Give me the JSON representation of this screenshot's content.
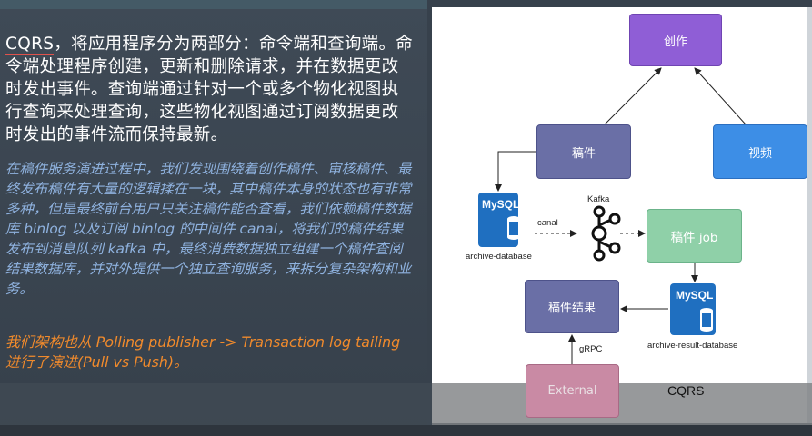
{
  "left": {
    "main_word": "CQRS",
    "main_rest": "，将应用程序分为两部分：命令端和查询端。命令端处理程序创建，更新和删除请求，并在数据更改时发出事件。查询端通过针对一个或多个物化视图执行查询来处理查询，这些物化视图通过订阅数据更改时发出的事件流而保持最新。",
    "blue_paragraph": "在稿件服务演进过程中，我们发现围绕着创作稿件、审核稿件、最终发布稿件有大量的逻辑揉在一块，其中稿件本身的状态也有非常多种，但是最终前台用户只关注稿件能否查看，我们依赖稿件数据库 binlog 以及订阅 binlog 的中间件 canal，将我们的稿件结果发布到消息队列 kafka 中，最终消费数据独立组建一个稿件查阅结果数据库，并对外提供一个独立查询服务，来拆分复杂架构和业务。",
    "orange_paragraph": "我们架构也从 Polling publisher -> Transaction log tailing 进行了演进(Pull vs Push)。"
  },
  "diagram": {
    "nodes": {
      "create": "创作",
      "draft": "稿件",
      "video": "视频",
      "job": "稿件 job",
      "result": "稿件结果",
      "external": "External"
    },
    "labels": {
      "kafka": "Kafka",
      "canal": "canal",
      "grpc": "gRPC",
      "archive_db": "archive-database",
      "archive_result_db": "archive-result-database",
      "mysql": "MySQL",
      "mysql_m": "M"
    },
    "caption": "CQRS"
  },
  "colors": {
    "create": "#8f5ed6",
    "draft": "#6a6fa6",
    "video": "#3d8ee6",
    "job": "#8fd0a8",
    "external": "#c98aa4",
    "mysql": "#1f6fc0"
  }
}
